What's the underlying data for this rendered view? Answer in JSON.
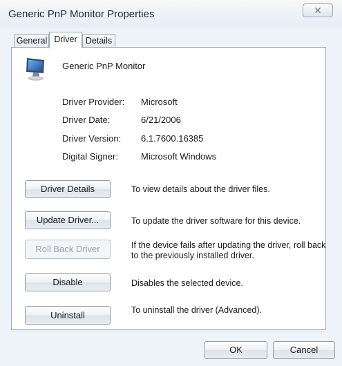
{
  "window": {
    "title": "Generic PnP Monitor Properties",
    "close_glyph": "✕"
  },
  "tabs": [
    {
      "label": "General",
      "active": false
    },
    {
      "label": "Driver",
      "active": true
    },
    {
      "label": "Details",
      "active": false
    }
  ],
  "device": {
    "name": "Generic PnP Monitor",
    "icon": "monitor-icon"
  },
  "info": [
    {
      "label": "Driver Provider:",
      "value": "Microsoft"
    },
    {
      "label": "Driver Date:",
      "value": "6/21/2006"
    },
    {
      "label": "Driver Version:",
      "value": "6.1.7600.16385"
    },
    {
      "label": "Digital Signer:",
      "value": "Microsoft Windows"
    }
  ],
  "actions": [
    {
      "button": "Driver Details",
      "description": "To view details about the driver files.",
      "enabled": true
    },
    {
      "button": "Update Driver...",
      "description": "To update the driver software for this device.",
      "enabled": true
    },
    {
      "button": "Roll Back Driver",
      "description": "If the device fails after updating the driver, roll back to the previously installed driver.",
      "enabled": false
    },
    {
      "button": "Disable",
      "description": "Disables the selected device.",
      "enabled": true
    },
    {
      "button": "Uninstall",
      "description": "To uninstall the driver (Advanced).",
      "enabled": true
    }
  ],
  "footer": {
    "ok_label": "OK",
    "cancel_label": "Cancel"
  },
  "colors": {
    "window_bg": "#eef3f9",
    "panel_bg": "#ffffff",
    "disabled_text": "#9aa1a9"
  }
}
